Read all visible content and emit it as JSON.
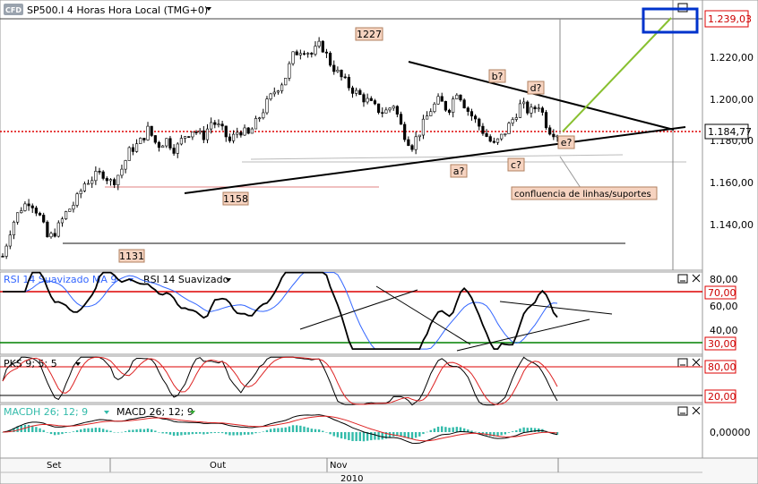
{
  "header": {
    "badge": "CFD",
    "title": "SP500.I 4 Horas Hora Local (TMG+0)"
  },
  "price_axis": {
    "ticks": [
      "1.220,00",
      "1.200,00",
      "1.180,00",
      "1.160,00",
      "1.140,00"
    ],
    "current_high": "1.239,03",
    "current_price": "1.184,77"
  },
  "annotations": {
    "high_1227": "1227",
    "low_1158": "1158",
    "low_1131": "1131",
    "wave_a": "a?",
    "wave_b": "b?",
    "wave_c": "c?",
    "wave_d": "d?",
    "wave_e": "e?",
    "note": "confluencia de linhas/suportes"
  },
  "rsi_panel": {
    "label_ma": "RSI 14 Suavizado MA 9",
    "label_rsi": "RSI 14 Suavizado",
    "ticks": [
      "80,00",
      "70,00",
      "60,00",
      "40,00",
      "30,00"
    ]
  },
  "pks_panel": {
    "label": "PKS 9; 5; 5",
    "ticks": [
      "80,00",
      "20,00"
    ]
  },
  "macd_panel": {
    "label_a": "MACDH 26; 12; 9",
    "label_b": "MACD 26; 12; 9",
    "ticks": [
      "0,00000"
    ]
  },
  "time_axis": {
    "months": [
      "Set",
      "Out",
      "Nov"
    ],
    "year": "2010"
  },
  "colors": {
    "resistance": "#dd0000",
    "support": "#008000",
    "trend_projection": "#88c030",
    "target_box": "#0033cc",
    "rsi_ma": "#3366ff",
    "pks_slow": "#dd2222",
    "macd_hist": "#33bbaa"
  },
  "chart_data": {
    "type": "candlestick",
    "title": "SP500.I 4 Horas Hora Local (TMG+0)",
    "x": [
      "Set",
      "Out",
      "Nov"
    ],
    "ylim": [
      1120,
      1240
    ],
    "key_levels": [
      1239.03,
      1184.77,
      1227,
      1158,
      1131
    ],
    "rsi": {
      "levels": [
        70,
        30
      ],
      "ylim": [
        20,
        80
      ]
    },
    "pks": {
      "levels": [
        80,
        20
      ]
    },
    "macd": {
      "zero": 0
    },
    "price_path": [
      1125,
      1140,
      1148,
      1152,
      1145,
      1133,
      1138,
      1146,
      1151,
      1160,
      1163,
      1165,
      1160,
      1166,
      1176,
      1179,
      1186,
      1178,
      1181,
      1176,
      1183,
      1186,
      1182,
      1190,
      1186,
      1180,
      1186,
      1183,
      1190,
      1198,
      1205,
      1210,
      1222,
      1225,
      1222,
      1227,
      1218,
      1212,
      1207,
      1203,
      1200,
      1196,
      1194,
      1198,
      1185,
      1178,
      1186,
      1195,
      1200,
      1195,
      1205,
      1196,
      1190,
      1184,
      1178,
      1183,
      1190,
      1198,
      1194,
      1198,
      1186,
      1184
    ]
  }
}
